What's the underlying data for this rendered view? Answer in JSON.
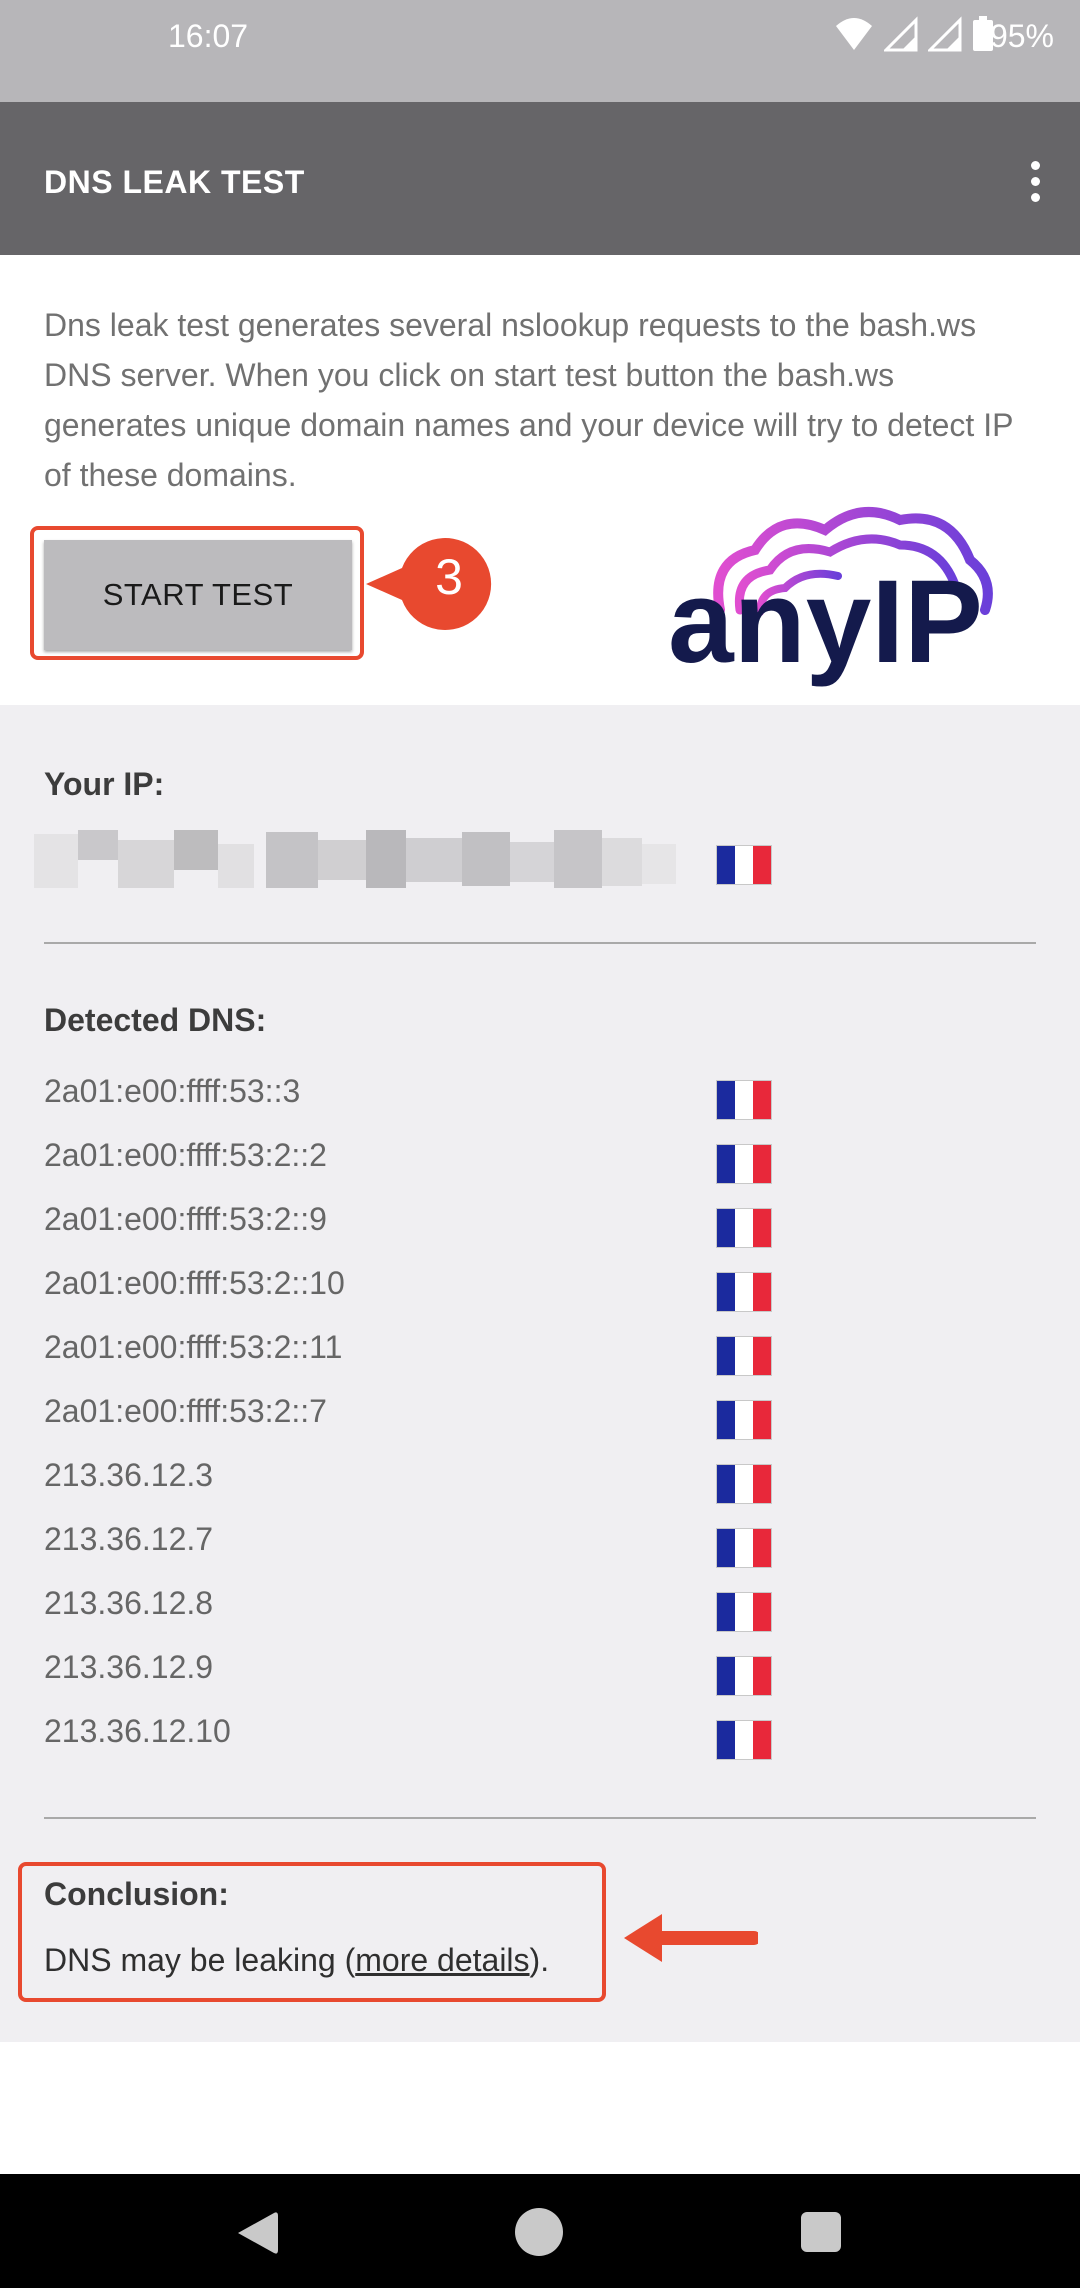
{
  "status_bar": {
    "time": "16:07",
    "battery": "95%"
  },
  "app_bar": {
    "title": "DNS LEAK TEST",
    "menu_icon": "overflow-menu-icon"
  },
  "intro_text": "Dns leak test generates several nslookup requests to the bash.ws DNS server. When you click on start test button the bash.ws generates unique domain names and your device will try to detect IP of these domains.",
  "start_button_label": "START TEST",
  "step_badge": "3",
  "logo": {
    "text": "anyIP"
  },
  "your_ip": {
    "label": "Your IP:",
    "country_flag": "flag-france"
  },
  "detected_dns": {
    "label": "Detected DNS:",
    "servers": [
      "2a01:e00:ffff:53::3",
      "2a01:e00:ffff:53:2::2",
      "2a01:e00:ffff:53:2::9",
      "2a01:e00:ffff:53:2::10",
      "2a01:e00:ffff:53:2::11",
      "2a01:e00:ffff:53:2::7",
      "213.36.12.3",
      "213.36.12.7",
      "213.36.12.8",
      "213.36.12.9",
      "213.36.12.10"
    ]
  },
  "conclusion": {
    "label": "Conclusion:",
    "text_before": "DNS may be leaking (",
    "link": "more details",
    "text_after": ")."
  },
  "colors": {
    "app_bar": "#666568",
    "status_bar": "#b7b6b9",
    "highlight": "#e8492f",
    "results_bg": "#f0eff2"
  }
}
